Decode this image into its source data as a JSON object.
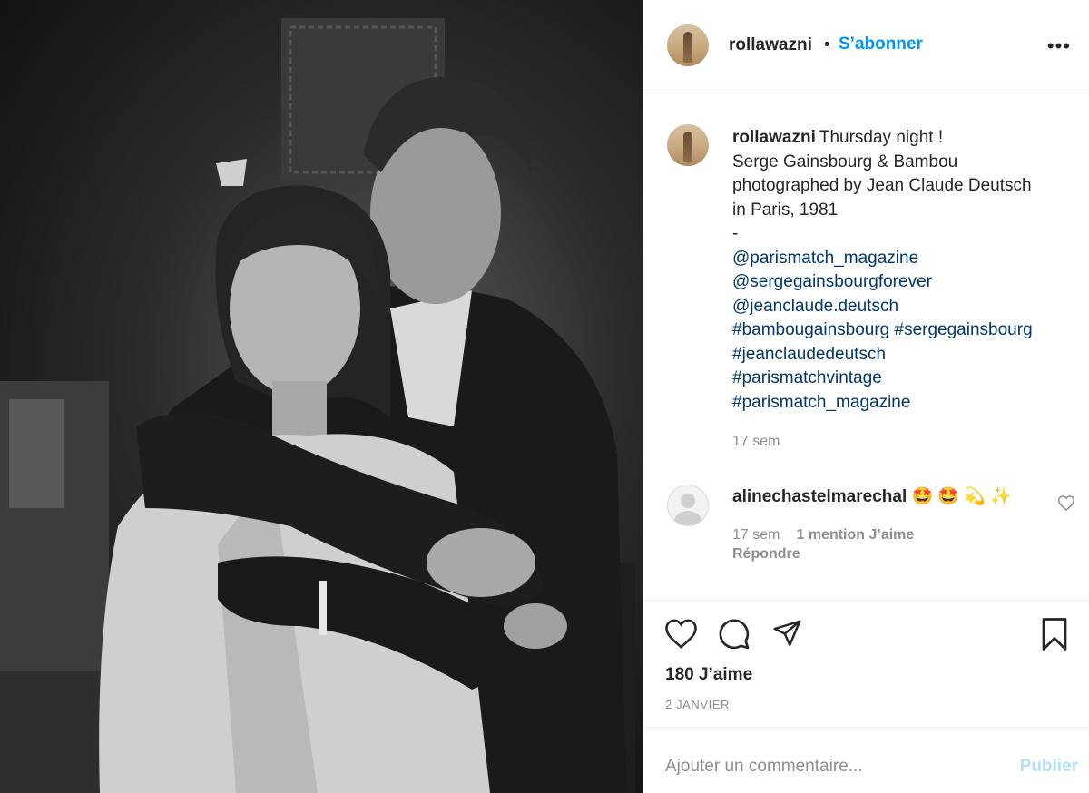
{
  "post": {
    "username": "rollawazni",
    "dot": "•",
    "follow_label": "S’abonner",
    "more_label": "•••",
    "caption": {
      "username": "rollawazni",
      "lines": [
        "Thursday night !",
        "Serge Gainsbourg & Bambou",
        "photographed by Jean Claude Deutsch",
        "in Paris, 1981",
        "-"
      ],
      "mentions": [
        "@parismatch_magazine",
        "@sergegainsbourgforever",
        "@jeanclaude.deutsch"
      ],
      "hashtags": [
        "#bambougainsbourg #sergegainsbourg",
        "#jeanclaudedeutsch",
        "#parismatchvintage",
        "#parismatch_magazine"
      ],
      "time": "17 sem"
    },
    "comment": {
      "username": "alinechastelmarechal",
      "emojis": "🤩 🤩 💫 ✨",
      "time": "17 sem",
      "likes": "1 mention J’aime",
      "reply": "Répondre"
    },
    "likes": "180 J’aime",
    "date": "2 JANVIER",
    "add_comment": {
      "placeholder": "Ajouter un commentaire...",
      "publish": "Publier"
    }
  },
  "icons": {
    "like": "heart-icon",
    "comment": "comment-icon",
    "share": "paper-plane-icon",
    "save": "bookmark-icon",
    "comment_like": "heart-icon"
  },
  "colors": {
    "link": "#00376b",
    "follow": "#0095f6",
    "muted": "#8e8e8e",
    "publish_disabled": "#b2dffc"
  }
}
